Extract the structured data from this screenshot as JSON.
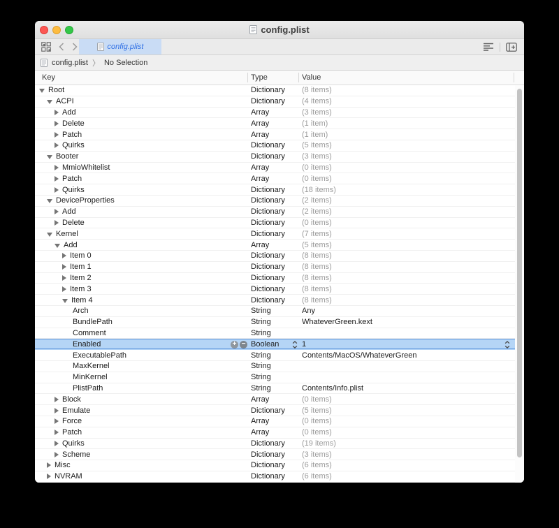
{
  "window": {
    "title": "config.plist"
  },
  "toolbar": {
    "tab_label": "config.plist"
  },
  "breadcrumb": {
    "file": "config.plist",
    "separator": "〉",
    "selection": "No Selection"
  },
  "accents": {
    "selection_bg": "#B5D5F6",
    "selection_border": "#5B94DB",
    "tab_bg": "#C9DCF5",
    "tab_text": "#2E6FE5",
    "traffic_red": "#FC5753",
    "traffic_yellow": "#FDBC40",
    "traffic_green": "#33C748"
  },
  "row_controls": {
    "add": "+",
    "remove": "−"
  },
  "table": {
    "columns": [
      "Key",
      "Type",
      "Value"
    ],
    "rows": [
      {
        "key": "Root",
        "type": "Dictionary",
        "value": "(8 items)",
        "level": 0,
        "disclosure": "expanded",
        "selected": false
      },
      {
        "key": "ACPI",
        "type": "Dictionary",
        "value": "(4 items)",
        "level": 1,
        "disclosure": "expanded",
        "selected": false
      },
      {
        "key": "Add",
        "type": "Array",
        "value": "(3 items)",
        "level": 2,
        "disclosure": "collapsed",
        "selected": false
      },
      {
        "key": "Delete",
        "type": "Array",
        "value": "(1 item)",
        "level": 2,
        "disclosure": "collapsed",
        "selected": false
      },
      {
        "key": "Patch",
        "type": "Array",
        "value": "(1 item)",
        "level": 2,
        "disclosure": "collapsed",
        "selected": false
      },
      {
        "key": "Quirks",
        "type": "Dictionary",
        "value": "(5 items)",
        "level": 2,
        "disclosure": "collapsed",
        "selected": false
      },
      {
        "key": "Booter",
        "type": "Dictionary",
        "value": "(3 items)",
        "level": 1,
        "disclosure": "expanded",
        "selected": false
      },
      {
        "key": "MmioWhitelist",
        "type": "Array",
        "value": "(0 items)",
        "level": 2,
        "disclosure": "collapsed",
        "selected": false
      },
      {
        "key": "Patch",
        "type": "Array",
        "value": "(0 items)",
        "level": 2,
        "disclosure": "collapsed",
        "selected": false
      },
      {
        "key": "Quirks",
        "type": "Dictionary",
        "value": "(18 items)",
        "level": 2,
        "disclosure": "collapsed",
        "selected": false
      },
      {
        "key": "DeviceProperties",
        "type": "Dictionary",
        "value": "(2 items)",
        "level": 1,
        "disclosure": "expanded",
        "selected": false
      },
      {
        "key": "Add",
        "type": "Dictionary",
        "value": "(2 items)",
        "level": 2,
        "disclosure": "collapsed",
        "selected": false
      },
      {
        "key": "Delete",
        "type": "Dictionary",
        "value": "(0 items)",
        "level": 2,
        "disclosure": "collapsed",
        "selected": false
      },
      {
        "key": "Kernel",
        "type": "Dictionary",
        "value": "(7 items)",
        "level": 1,
        "disclosure": "expanded",
        "selected": false
      },
      {
        "key": "Add",
        "type": "Array",
        "value": "(5 items)",
        "level": 2,
        "disclosure": "expanded",
        "selected": false
      },
      {
        "key": "Item 0",
        "type": "Dictionary",
        "value": "(8 items)",
        "level": 3,
        "disclosure": "collapsed",
        "selected": false
      },
      {
        "key": "Item 1",
        "type": "Dictionary",
        "value": "(8 items)",
        "level": 3,
        "disclosure": "collapsed",
        "selected": false
      },
      {
        "key": "Item 2",
        "type": "Dictionary",
        "value": "(8 items)",
        "level": 3,
        "disclosure": "collapsed",
        "selected": false
      },
      {
        "key": "Item 3",
        "type": "Dictionary",
        "value": "(8 items)",
        "level": 3,
        "disclosure": "collapsed",
        "selected": false
      },
      {
        "key": "Item 4",
        "type": "Dictionary",
        "value": "(8 items)",
        "level": 3,
        "disclosure": "expanded",
        "selected": false
      },
      {
        "key": "Arch",
        "type": "String",
        "value": "Any",
        "level": 4,
        "disclosure": "none",
        "selected": false
      },
      {
        "key": "BundlePath",
        "type": "String",
        "value": "WhateverGreen.kext",
        "level": 4,
        "disclosure": "none",
        "selected": false
      },
      {
        "key": "Comment",
        "type": "String",
        "value": "",
        "level": 4,
        "disclosure": "none",
        "selected": false
      },
      {
        "key": "Enabled",
        "type": "Boolean",
        "value": "1",
        "level": 4,
        "disclosure": "none",
        "selected": true
      },
      {
        "key": "ExecutablePath",
        "type": "String",
        "value": "Contents/MacOS/WhateverGreen",
        "level": 4,
        "disclosure": "none",
        "selected": false
      },
      {
        "key": "MaxKernel",
        "type": "String",
        "value": "",
        "level": 4,
        "disclosure": "none",
        "selected": false
      },
      {
        "key": "MinKernel",
        "type": "String",
        "value": "",
        "level": 4,
        "disclosure": "none",
        "selected": false
      },
      {
        "key": "PlistPath",
        "type": "String",
        "value": "Contents/Info.plist",
        "level": 4,
        "disclosure": "none",
        "selected": false
      },
      {
        "key": "Block",
        "type": "Array",
        "value": "(0 items)",
        "level": 2,
        "disclosure": "collapsed",
        "selected": false
      },
      {
        "key": "Emulate",
        "type": "Dictionary",
        "value": "(5 items)",
        "level": 2,
        "disclosure": "collapsed",
        "selected": false
      },
      {
        "key": "Force",
        "type": "Array",
        "value": "(0 items)",
        "level": 2,
        "disclosure": "collapsed",
        "selected": false
      },
      {
        "key": "Patch",
        "type": "Array",
        "value": "(0 items)",
        "level": 2,
        "disclosure": "collapsed",
        "selected": false
      },
      {
        "key": "Quirks",
        "type": "Dictionary",
        "value": "(19 items)",
        "level": 2,
        "disclosure": "collapsed",
        "selected": false
      },
      {
        "key": "Scheme",
        "type": "Dictionary",
        "value": "(3 items)",
        "level": 2,
        "disclosure": "collapsed",
        "selected": false
      },
      {
        "key": "Misc",
        "type": "Dictionary",
        "value": "(6 items)",
        "level": 1,
        "disclosure": "collapsed",
        "selected": false
      },
      {
        "key": "NVRAM",
        "type": "Dictionary",
        "value": "(6 items)",
        "level": 1,
        "disclosure": "collapsed",
        "selected": false
      }
    ]
  }
}
